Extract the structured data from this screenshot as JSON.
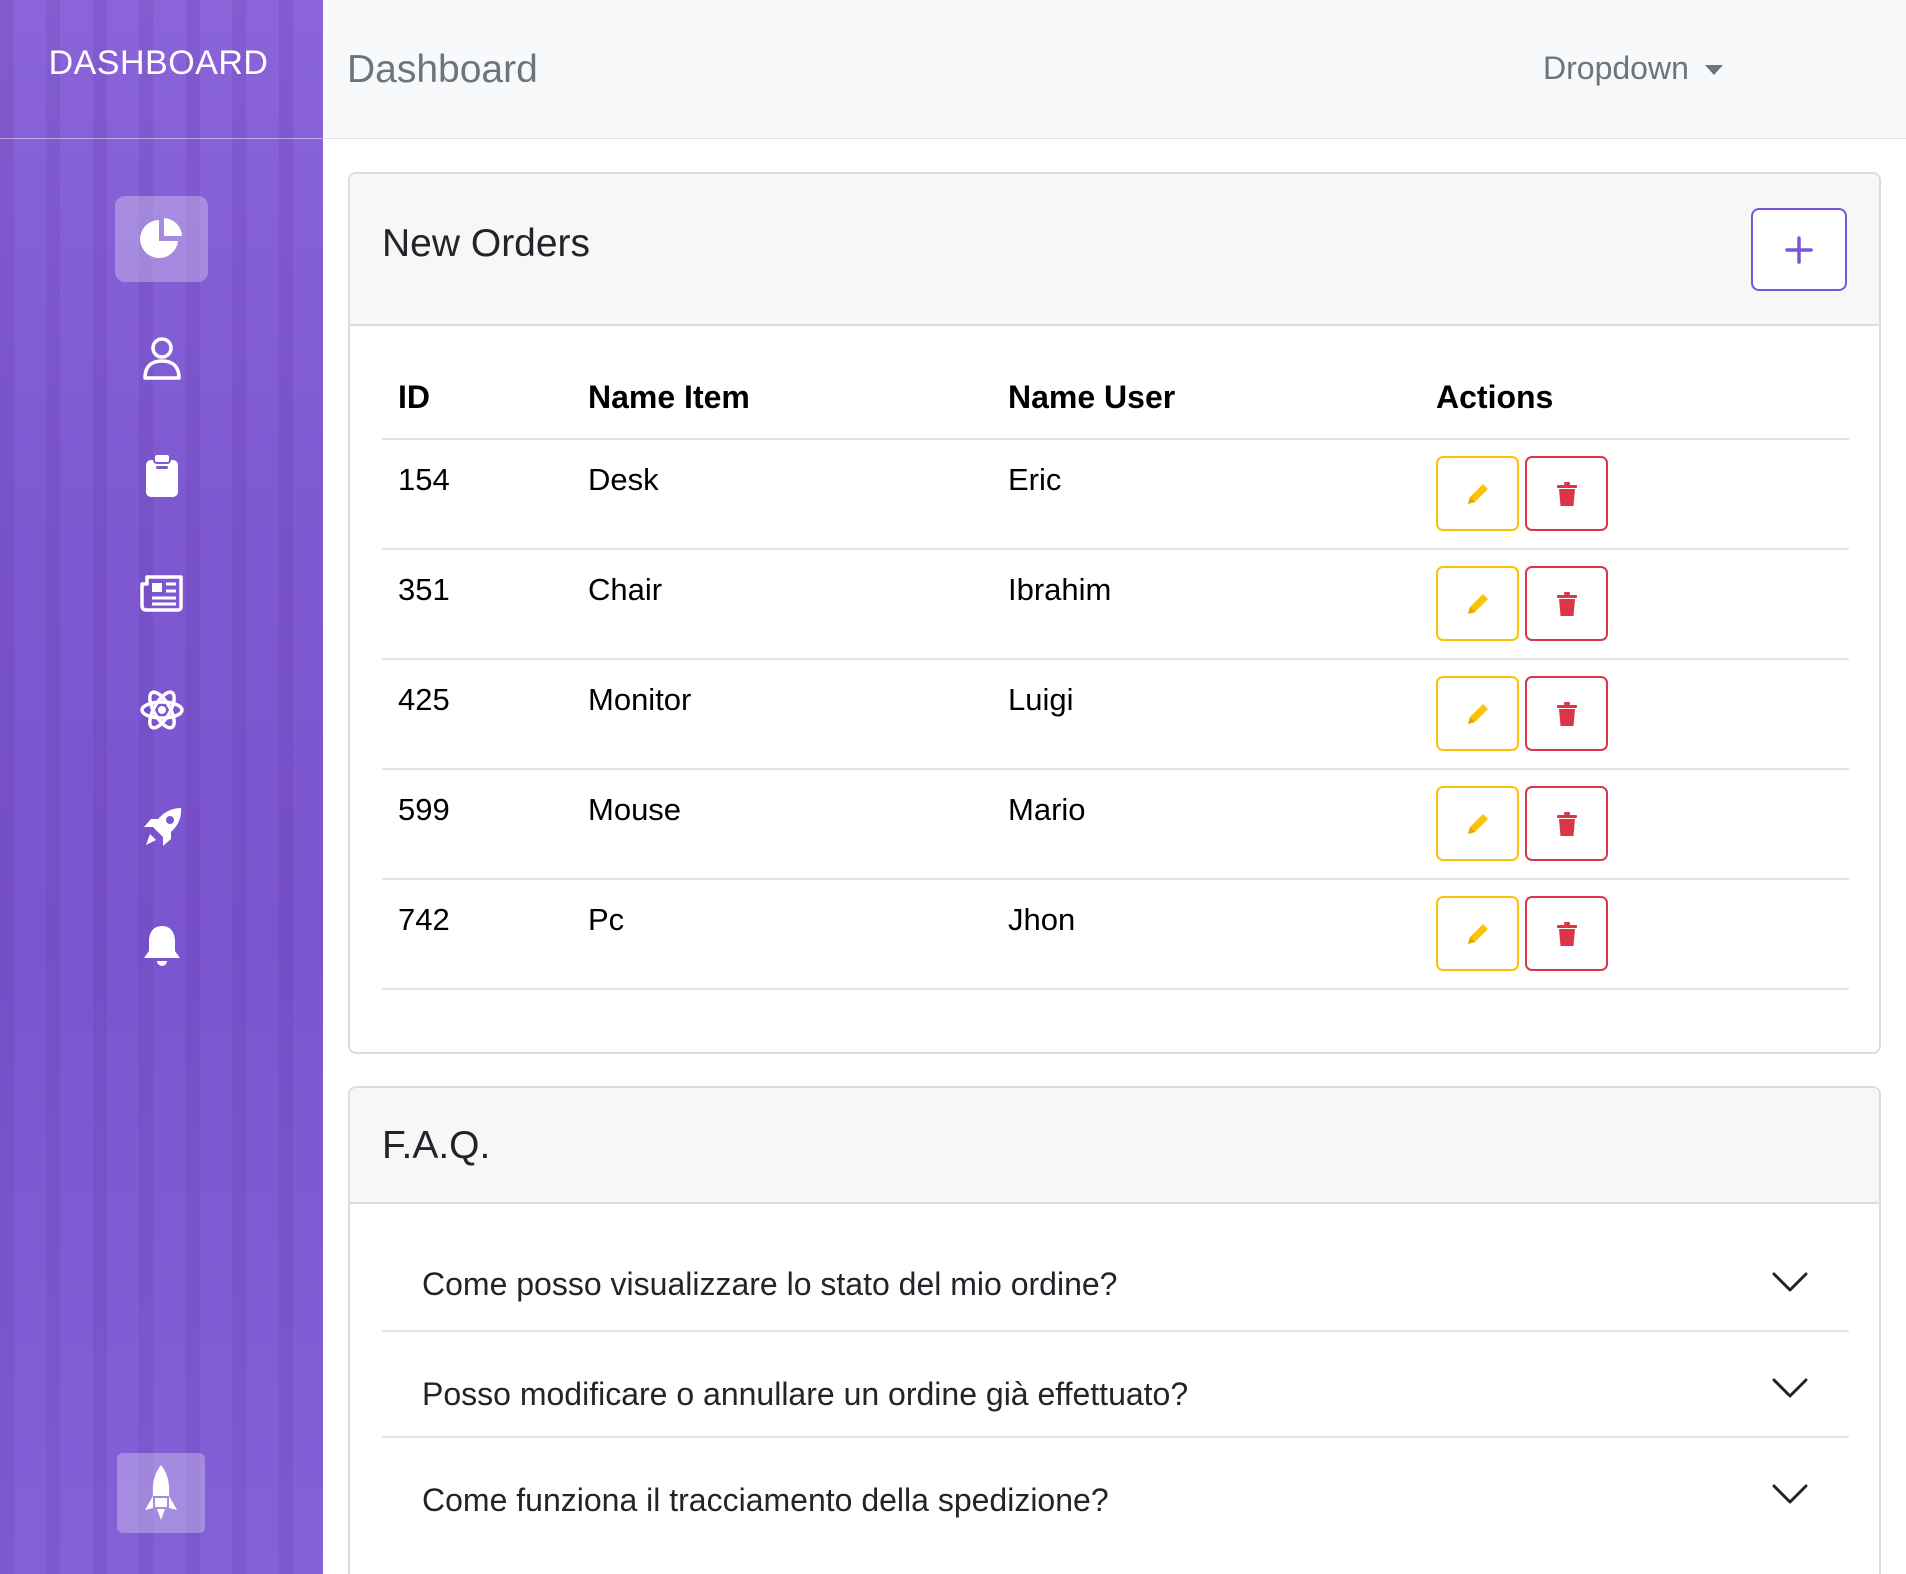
{
  "sidebar": {
    "brand": "DASHBOARD",
    "items": [
      {
        "icon": "pie-chart-icon",
        "active": true
      },
      {
        "icon": "person-icon",
        "active": false
      },
      {
        "icon": "clipboard-icon",
        "active": false
      },
      {
        "icon": "newspaper-icon",
        "active": false
      },
      {
        "icon": "atom-icon",
        "active": false
      },
      {
        "icon": "rocket-icon",
        "active": false
      },
      {
        "icon": "bell-icon",
        "active": false
      }
    ],
    "footer_icon": "rocket-takeoff-icon",
    "accent_color": "#7e58d0"
  },
  "topbar": {
    "title": "Dashboard",
    "dropdown_label": "Dropdown"
  },
  "orders": {
    "title": "New Orders",
    "add_icon": "plus-icon",
    "columns": [
      "ID",
      "Name Item",
      "Name User",
      "Actions"
    ],
    "rows": [
      {
        "id": "154",
        "item": "Desk",
        "user": "Eric"
      },
      {
        "id": "351",
        "item": "Chair",
        "user": "Ibrahim"
      },
      {
        "id": "425",
        "item": "Monitor",
        "user": "Luigi"
      },
      {
        "id": "599",
        "item": "Mouse",
        "user": "Mario"
      },
      {
        "id": "742",
        "item": "Pc",
        "user": "Jhon"
      }
    ],
    "edit_icon": "pencil-icon",
    "delete_icon": "trash-icon",
    "edit_color": "#ffc107",
    "delete_color": "#dc3545"
  },
  "faq": {
    "title": "F.A.Q.",
    "questions": [
      "Come posso visualizzare lo stato del mio ordine?",
      "Posso modificare o annullare un ordine già effettuato?",
      "Come funziona il tracciamento della spedizione?"
    ]
  }
}
